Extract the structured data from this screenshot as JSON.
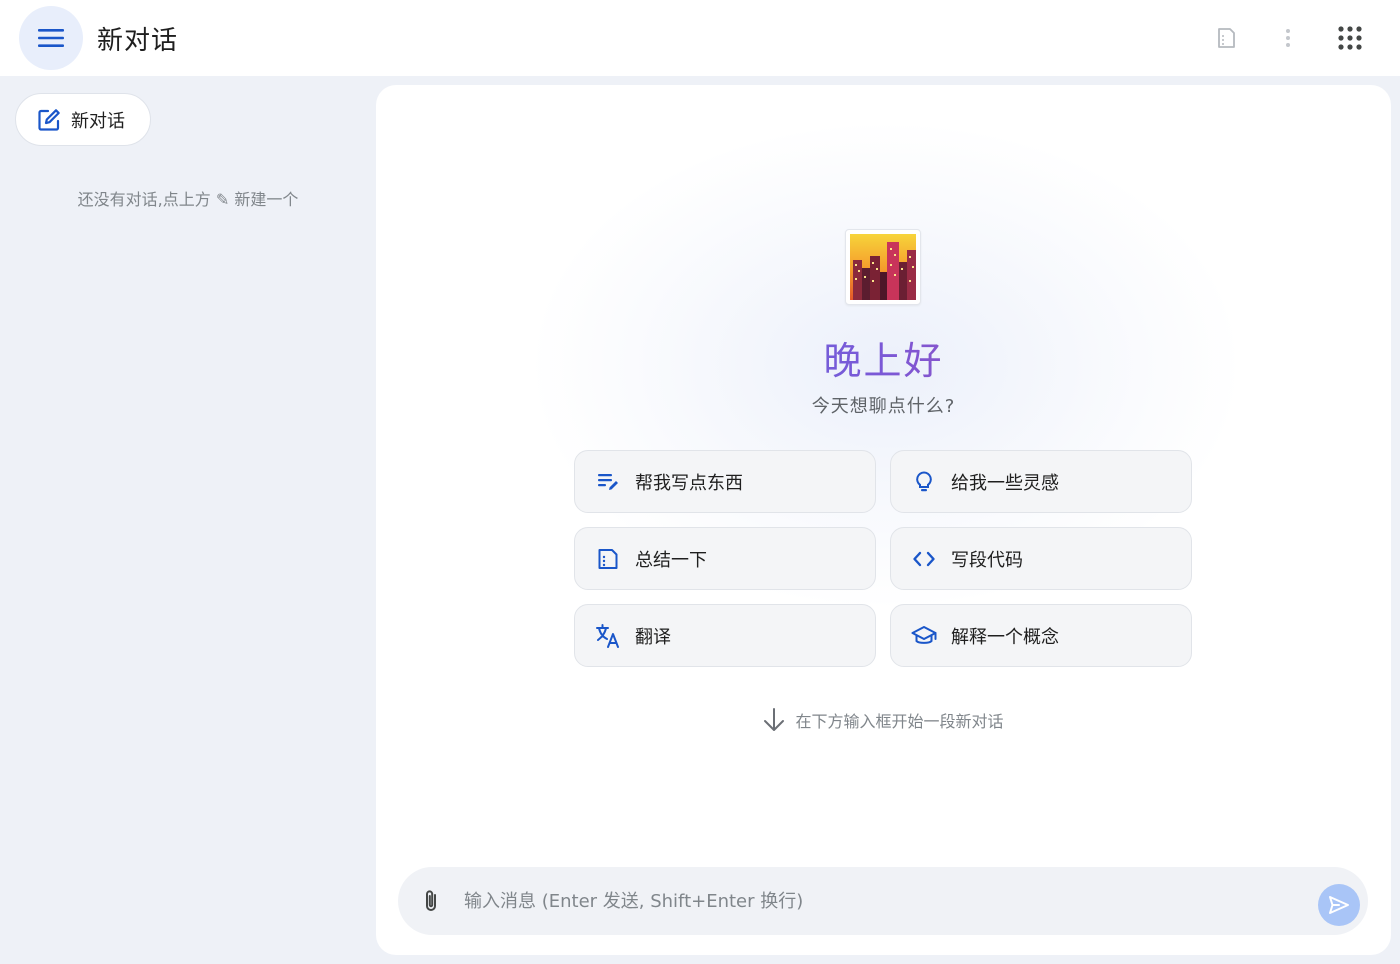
{
  "header": {
    "title": "新对话",
    "menu_icon": "hamburger-menu-icon",
    "actions": [
      "summary-doc-icon",
      "more-vert-icon",
      "apps-grid-icon"
    ]
  },
  "sidebar": {
    "new_chat_label": "新对话",
    "empty_hint": "还没有对话,点上方 ✎ 新建一个"
  },
  "main": {
    "logo": "night-city-emoji-icon",
    "greeting": "晚上好",
    "subtitle": "今天想聊点什么?",
    "suggestions": [
      {
        "label": "帮我写点东西",
        "icon": "write-edit-icon"
      },
      {
        "label": "给我一些灵感",
        "icon": "lightbulb-icon"
      },
      {
        "label": "总结一下",
        "icon": "summary-doc-icon"
      },
      {
        "label": "写段代码",
        "icon": "code-icon"
      },
      {
        "label": "翻译",
        "icon": "translate-icon"
      },
      {
        "label": "解释一个概念",
        "icon": "school-icon"
      }
    ],
    "down_hint": "在下方输入框开始一段新对话"
  },
  "composer": {
    "placeholder": "输入消息 (Enter 发送, Shift+Enter 换行)",
    "value": ""
  },
  "colors": {
    "accent": "#1a73e8",
    "greeting_gradient": [
      "#4a78e8",
      "#7b58d6",
      "#d33d86"
    ],
    "send_button": "#a9c5f7"
  }
}
